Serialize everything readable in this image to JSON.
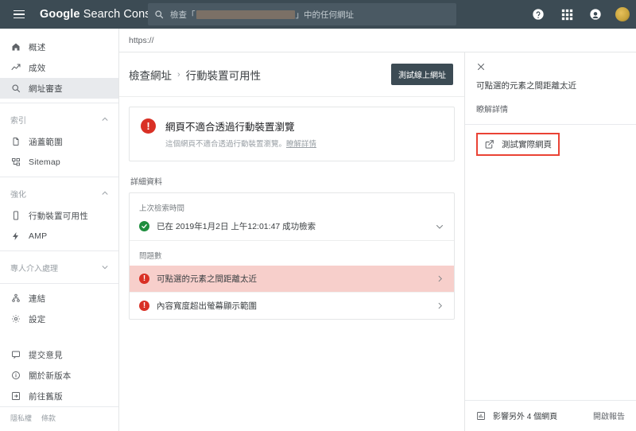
{
  "topbar": {
    "menu_icon": "hamburger-icon",
    "brand_bold": "Google",
    "brand_rest": "Search Console",
    "search": {
      "icon": "search-icon",
      "placeholder_prefix": "檢查「",
      "placeholder_suffix": "」中的任何網址"
    },
    "icons": [
      {
        "name": "help-icon",
        "glyph": "?"
      },
      {
        "name": "apps-grid-icon",
        "glyph": "apps"
      },
      {
        "name": "notifications-icon",
        "glyph": "circle"
      },
      {
        "name": "avatar",
        "glyph": "avatar"
      }
    ],
    "bg_color": "#3c4b54"
  },
  "sidebar": {
    "top_items": [
      {
        "label": "概述",
        "icon": "home-icon",
        "active": false
      },
      {
        "label": "成效",
        "icon": "trending-up-icon",
        "active": false
      },
      {
        "label": "網址審查",
        "icon": "search-icon",
        "active": true
      }
    ],
    "groups": [
      {
        "title": "索引",
        "chevron": "chevron-up-icon",
        "items": [
          {
            "label": "涵蓋範圍",
            "icon": "document-icon"
          },
          {
            "label": "Sitemap",
            "icon": "sitemap-icon"
          }
        ]
      },
      {
        "title": "強化",
        "chevron": "chevron-up-icon",
        "items": [
          {
            "label": "行動裝置可用性",
            "icon": "mobile-icon"
          },
          {
            "label": "AMP",
            "icon": "bolt-icon"
          }
        ]
      },
      {
        "title": "專人介入處理",
        "chevron": "chevron-down-icon",
        "items": []
      }
    ],
    "lower_items": [
      {
        "label": "連結",
        "icon": "links-icon"
      },
      {
        "label": "設定",
        "icon": "gear-icon"
      }
    ],
    "bottom_items": [
      {
        "label": "提交意見",
        "icon": "feedback-icon"
      },
      {
        "label": "關於新版本",
        "icon": "info-icon"
      },
      {
        "label": "前往舊版",
        "icon": "exit-icon"
      }
    ],
    "legal": [
      "隱私權",
      "條款"
    ]
  },
  "url_strip": {
    "text": "https://"
  },
  "main": {
    "breadcrumb": {
      "parent": "檢查網址",
      "separator": "›",
      "current": "行動裝置可用性"
    },
    "test_button": "測試線上網址",
    "status": {
      "icon": "error-icon",
      "title": "網頁不適合透過行動裝置瀏覽",
      "subtitle": "這個網頁不適合透過行動裝置瀏覽。",
      "subtitle_link": "瞭解詳情",
      "accent_color": "#d93025"
    },
    "details_label": "詳細資料",
    "crawl": {
      "caption": "上次檢索時間",
      "icon": "check-circle-icon",
      "text": "已在 2019年1月2日 上午12:01:47 成功檢索",
      "chevron": "chevron-down-icon"
    },
    "issues_caption": "問題數",
    "issues": [
      {
        "label": "可點選的元素之間距離太近",
        "icon": "error-icon",
        "selected": true,
        "chevron": "chevron-right-icon"
      },
      {
        "label": "內容寬度超出螢幕顯示範圍",
        "icon": "error-icon",
        "selected": false,
        "chevron": "chevron-right-icon"
      }
    ]
  },
  "right_panel": {
    "close_icon": "close-icon",
    "title": "可點選的元素之間距離太近",
    "learn_more": "瞭解詳情",
    "action": {
      "icon": "external-link-icon",
      "label": "測試實際網頁",
      "highlight_color": "#ea4335"
    },
    "footer": {
      "icon": "bar-chart-icon",
      "affected": "影響另外 4 個網頁",
      "report_link": "開啟報告"
    }
  }
}
